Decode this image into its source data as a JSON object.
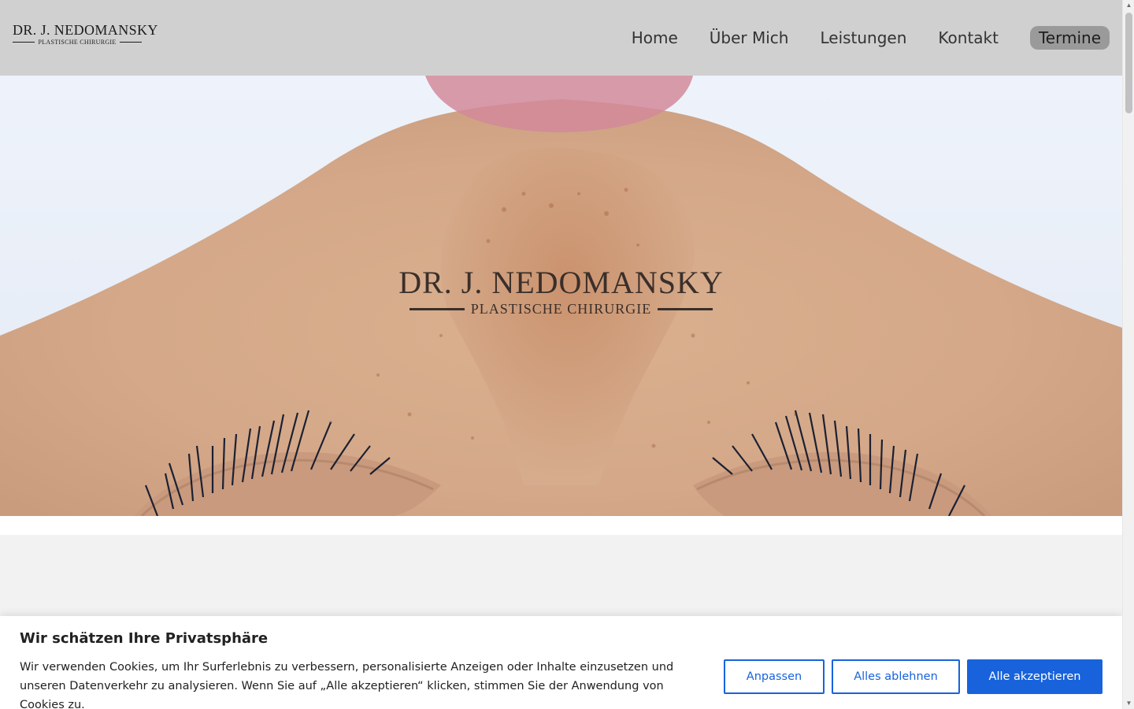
{
  "header": {
    "logo": {
      "name": "DR. J. NEDOMANSKY",
      "subtitle": "PLASTISCHE CHIRURGIE"
    },
    "nav": {
      "home": "Home",
      "about": "Über Mich",
      "services": "Leistungen",
      "contact": "Kontakt",
      "appointments": "Termine"
    },
    "colors": {
      "background": "#d0d0d0",
      "cta_background": "#9a9a9a"
    }
  },
  "hero": {
    "image": "close-up-face-with-freckles-and-eyelashes",
    "logo": {
      "name": "DR. J. NEDOMANSKY",
      "subtitle": "PLASTISCHE CHIRURGIE"
    }
  },
  "cookie_banner": {
    "title": "Wir schätzen Ihre Privatsphäre",
    "text": "Wir verwenden Cookies, um Ihr Surferlebnis zu verbessern, personalisierte Anzeigen oder Inhalte einzusetzen und unseren Datenverkehr zu analysieren. Wenn Sie auf „Alle akzeptieren“ klicken, stimmen Sie der Anwendung von Cookies zu.",
    "buttons": {
      "customize": "Anpassen",
      "reject": "Alles ablehnen",
      "accept": "Alle akzeptieren"
    },
    "colors": {
      "accent": "#1863dc"
    }
  },
  "scrollbar": {
    "up_icon": "arrow-up-icon",
    "down_icon": "arrow-down-icon"
  }
}
